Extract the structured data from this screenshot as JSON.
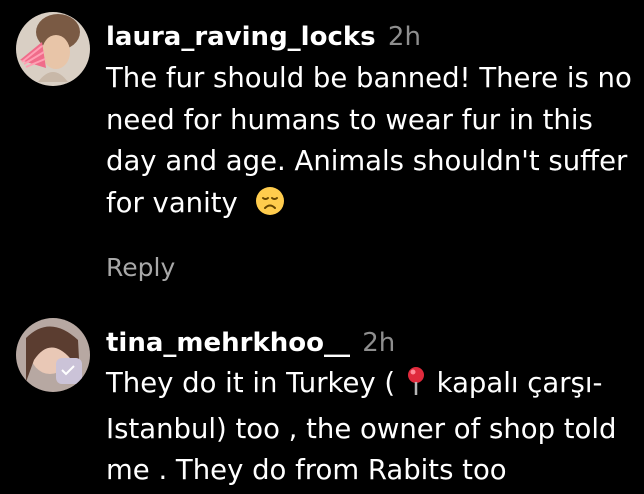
{
  "comments": [
    {
      "username": "laura_raving_locks",
      "time": "2h",
      "lines": [
        "The fur should be banned! There is no",
        "need for humans to wear fur in this",
        "day and age. Animals shouldn't suffer",
        "for vanity"
      ],
      "emoji": "disappointed-face-emoji",
      "reply_label": "Reply"
    },
    {
      "username": "tina_mehrkhoo__",
      "time": "2h",
      "lines_before_pin": "They do it in Turkey (",
      "pin_icon": "round-pushpin-emoji",
      "lines_after_pin": " kapalı çarşı-",
      "lines": [
        "Istanbul) too , the owner of shop told",
        "me . They do from Rabits too"
      ]
    }
  ],
  "colors": {
    "background": "#000000",
    "text": "#ffffff",
    "meta": "#8e8e8e",
    "reply": "#a8a8a8"
  }
}
